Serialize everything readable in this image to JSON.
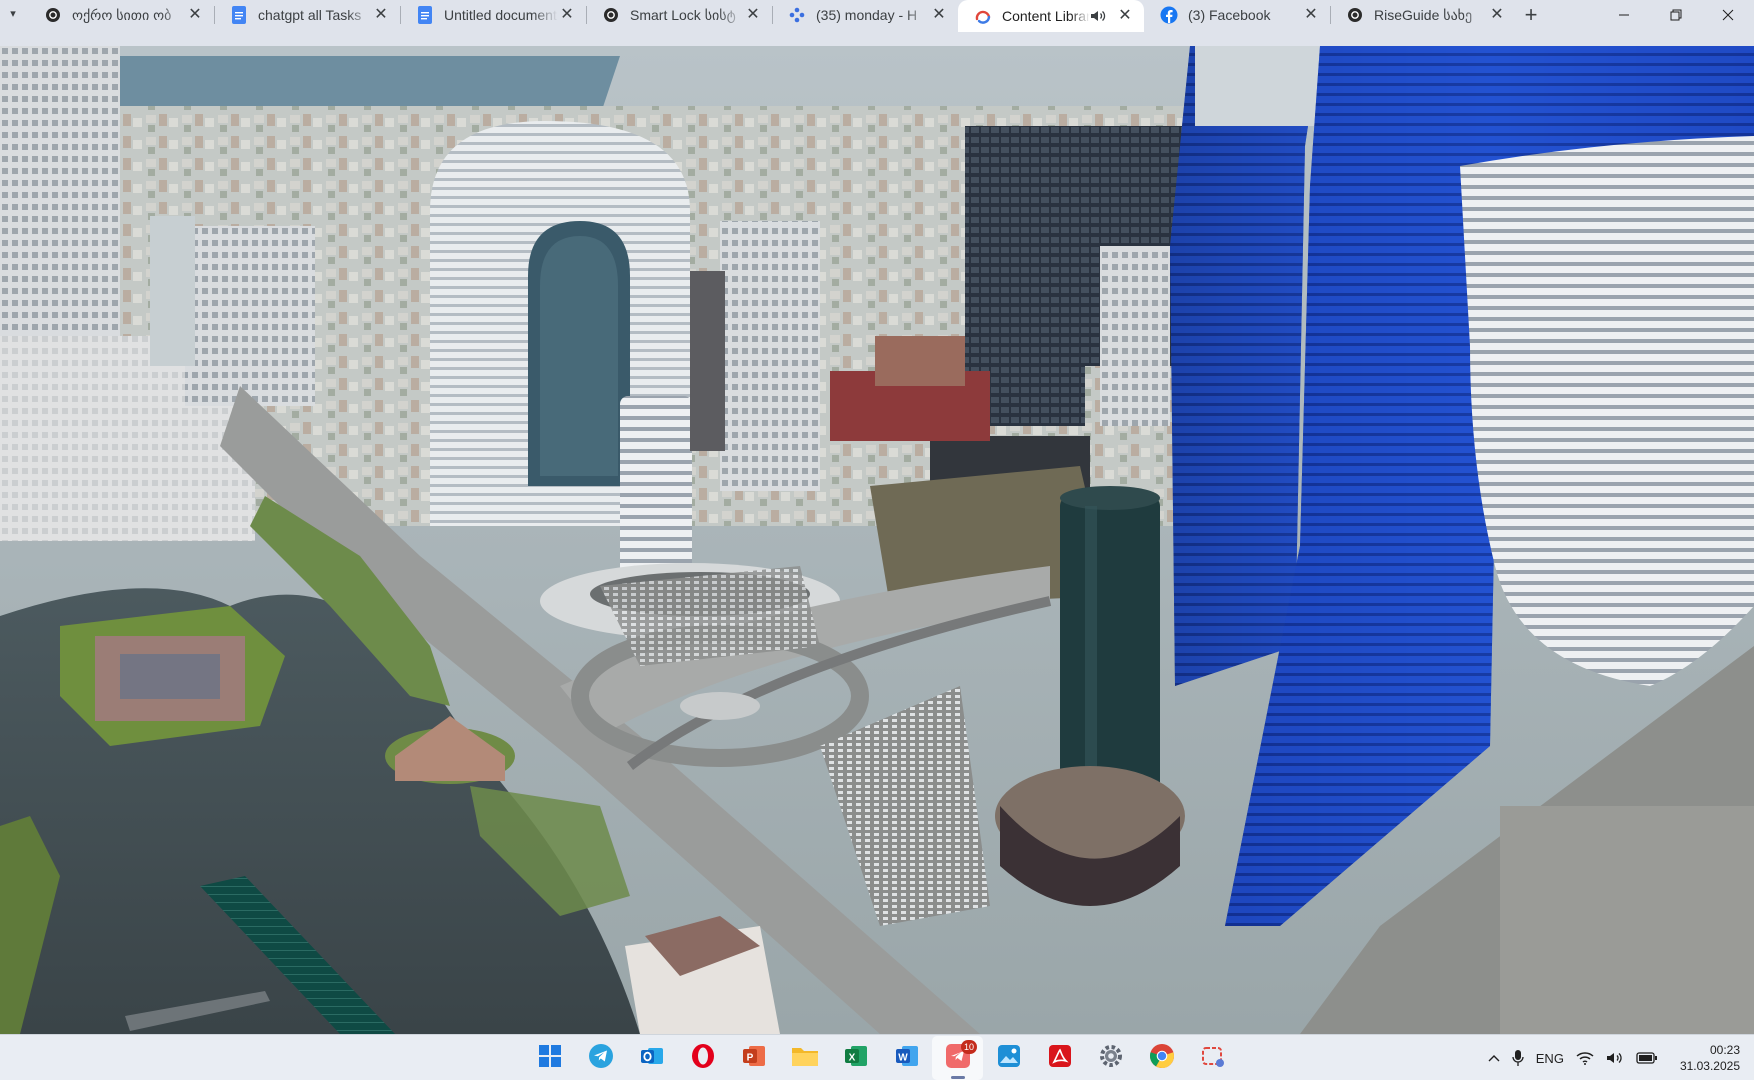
{
  "browser": {
    "tabs": [
      {
        "title": "ოქრო სითი ობ",
        "icon": "chatgpt-icon",
        "active": false,
        "audio": false
      },
      {
        "title": "chatgpt all Tasks",
        "icon": "google-docs-icon",
        "active": false,
        "audio": false
      },
      {
        "title": "Untitled document",
        "icon": "google-docs-icon",
        "active": false,
        "audio": false
      },
      {
        "title": "Smart Lock სისტ",
        "icon": "chatgpt-icon",
        "active": false,
        "audio": false
      },
      {
        "title": "(35) monday - H",
        "icon": "monday-icon",
        "active": false,
        "audio": false
      },
      {
        "title": "Content Library",
        "icon": "content-library-icon",
        "active": true,
        "audio": true
      },
      {
        "title": "(3) Facebook",
        "icon": "facebook-icon",
        "active": false,
        "audio": false
      },
      {
        "title": "RiseGuide სახე",
        "icon": "chatgpt-icon",
        "active": false,
        "audio": false
      }
    ],
    "new_tab_label": "+",
    "close_glyph": "✕"
  },
  "taskbar": {
    "apps": [
      {
        "name": "windows-start",
        "icon": "windows-logo-icon",
        "active": false
      },
      {
        "name": "telegram",
        "icon": "telegram-icon",
        "active": false
      },
      {
        "name": "outlook",
        "icon": "outlook-icon",
        "active": false
      },
      {
        "name": "opera",
        "icon": "opera-icon",
        "active": false
      },
      {
        "name": "powerpoint",
        "icon": "powerpoint-icon",
        "active": false
      },
      {
        "name": "file-explorer",
        "icon": "folder-icon",
        "active": false
      },
      {
        "name": "excel",
        "icon": "excel-icon",
        "active": false
      },
      {
        "name": "word",
        "icon": "word-icon",
        "active": false
      },
      {
        "name": "telegram-notifications",
        "icon": "paper-plane-icon",
        "active": true,
        "badge": "10"
      },
      {
        "name": "photos",
        "icon": "photos-icon",
        "active": false
      },
      {
        "name": "acrobat",
        "icon": "acrobat-icon",
        "active": false
      },
      {
        "name": "settings",
        "icon": "gear-icon",
        "active": false
      },
      {
        "name": "chrome",
        "icon": "chrome-icon",
        "active": false
      },
      {
        "name": "snipping-tool",
        "icon": "snipping-tool-icon",
        "active": false
      }
    ],
    "tray": {
      "language": "ENG",
      "time": "00:23",
      "date": "31.03.2025"
    }
  },
  "colors": {
    "tab_strip": "#dfe3eb",
    "active_tab": "#ffffff",
    "taskbar": "#e9edf3",
    "badge": "#c42b1c",
    "tower_blue": "#1f49c9"
  }
}
